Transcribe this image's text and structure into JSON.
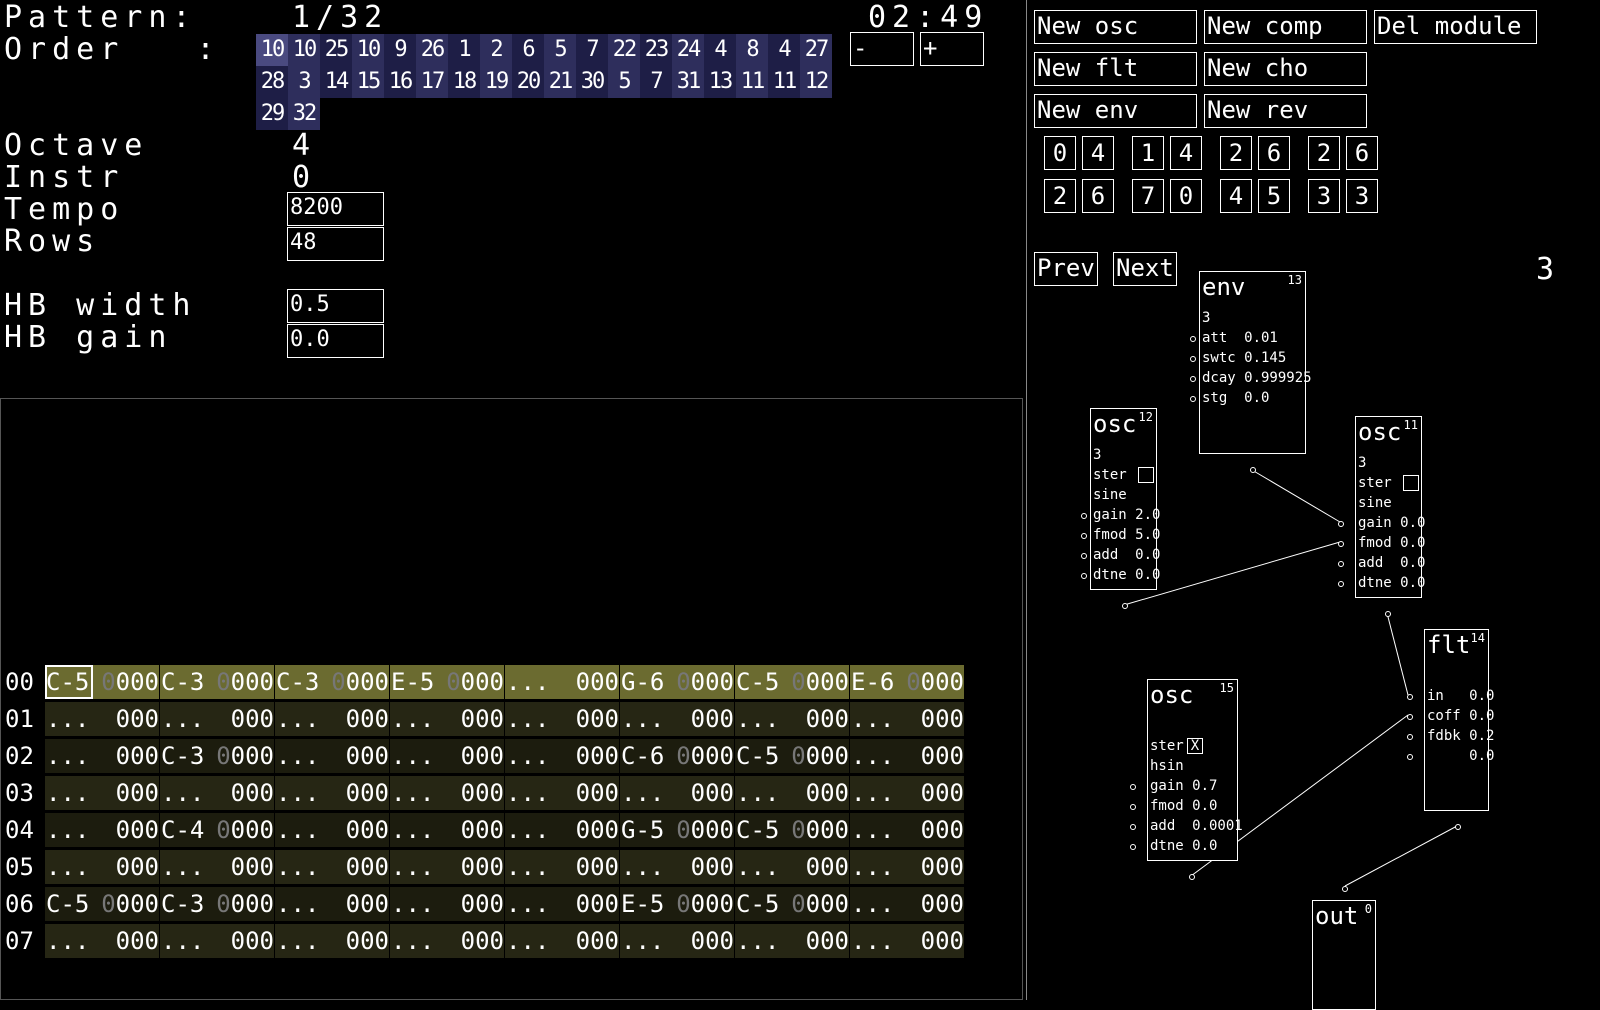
{
  "header": {
    "pattern_label": "Pattern:",
    "pattern_value": "1/32",
    "time": "02:49",
    "order_label": "Order   :",
    "order_cells": [
      "10",
      "10",
      "25",
      "10",
      "9",
      "26",
      "1",
      "2",
      "6",
      "5",
      "7",
      "22",
      "23",
      "24",
      "4",
      "8",
      "4",
      "27",
      "28",
      "3",
      "14",
      "15",
      "16",
      "17",
      "18",
      "19",
      "20",
      "21",
      "30",
      "5",
      "7",
      "31",
      "13",
      "11",
      "11",
      "12",
      "29",
      "32"
    ],
    "order_minus": "-",
    "order_plus": "+",
    "octave_label": "Octave",
    "octave_value": "4",
    "instr_label": "Instr",
    "instr_value": "0",
    "tempo_label": "Tempo",
    "tempo_value": "8200",
    "rows_label": "Rows",
    "rows_value": "48",
    "hb_width_label": "HB width",
    "hb_width_value": "0.5",
    "hb_gain_label": "HB gain",
    "hb_gain_value": "0.0"
  },
  "pattern": {
    "rows": [
      {
        "num": "00",
        "cells": [
          {
            "n": "C-5",
            "d": "0000"
          },
          {
            "n": "C-3",
            "d": "0000"
          },
          {
            "n": "C-3",
            "d": "0000"
          },
          {
            "n": "E-5",
            "d": "0000"
          },
          {
            "n": "...",
            "d": "000"
          },
          {
            "n": "G-6",
            "d": "0000"
          },
          {
            "n": "C-5",
            "d": "0000"
          },
          {
            "n": "E-6",
            "d": "0000"
          }
        ]
      },
      {
        "num": "01",
        "cells": [
          {
            "n": "...",
            "d": "000"
          },
          {
            "n": "...",
            "d": "000"
          },
          {
            "n": "...",
            "d": "000"
          },
          {
            "n": "...",
            "d": "000"
          },
          {
            "n": "...",
            "d": "000"
          },
          {
            "n": "...",
            "d": "000"
          },
          {
            "n": "...",
            "d": "000"
          },
          {
            "n": "...",
            "d": "000"
          }
        ]
      },
      {
        "num": "02",
        "cells": [
          {
            "n": "...",
            "d": "000"
          },
          {
            "n": "C-3",
            "d": "0000"
          },
          {
            "n": "...",
            "d": "000"
          },
          {
            "n": "...",
            "d": "000"
          },
          {
            "n": "...",
            "d": "000"
          },
          {
            "n": "C-6",
            "d": "0000"
          },
          {
            "n": "C-5",
            "d": "0000"
          },
          {
            "n": "...",
            "d": "000"
          }
        ]
      },
      {
        "num": "03",
        "cells": [
          {
            "n": "...",
            "d": "000"
          },
          {
            "n": "...",
            "d": "000"
          },
          {
            "n": "...",
            "d": "000"
          },
          {
            "n": "...",
            "d": "000"
          },
          {
            "n": "...",
            "d": "000"
          },
          {
            "n": "...",
            "d": "000"
          },
          {
            "n": "...",
            "d": "000"
          },
          {
            "n": "...",
            "d": "000"
          }
        ]
      },
      {
        "num": "04",
        "cells": [
          {
            "n": "...",
            "d": "000"
          },
          {
            "n": "C-4",
            "d": "0000"
          },
          {
            "n": "...",
            "d": "000"
          },
          {
            "n": "...",
            "d": "000"
          },
          {
            "n": "...",
            "d": "000"
          },
          {
            "n": "G-5",
            "d": "0000"
          },
          {
            "n": "C-5",
            "d": "0000"
          },
          {
            "n": "...",
            "d": "000"
          }
        ]
      },
      {
        "num": "05",
        "cells": [
          {
            "n": "...",
            "d": "000"
          },
          {
            "n": "...",
            "d": "000"
          },
          {
            "n": "...",
            "d": "000"
          },
          {
            "n": "...",
            "d": "000"
          },
          {
            "n": "...",
            "d": "000"
          },
          {
            "n": "...",
            "d": "000"
          },
          {
            "n": "...",
            "d": "000"
          },
          {
            "n": "...",
            "d": "000"
          }
        ]
      },
      {
        "num": "06",
        "cells": [
          {
            "n": "C-5",
            "d": "0000"
          },
          {
            "n": "C-3",
            "d": "0000"
          },
          {
            "n": "...",
            "d": "000"
          },
          {
            "n": "...",
            "d": "000"
          },
          {
            "n": "...",
            "d": "000"
          },
          {
            "n": "E-5",
            "d": "0000"
          },
          {
            "n": "C-5",
            "d": "0000"
          },
          {
            "n": "...",
            "d": "000"
          }
        ]
      },
      {
        "num": "07",
        "cells": [
          {
            "n": "...",
            "d": "000"
          },
          {
            "n": "...",
            "d": "000"
          },
          {
            "n": "...",
            "d": "000"
          },
          {
            "n": "...",
            "d": "000"
          },
          {
            "n": "...",
            "d": "000"
          },
          {
            "n": "...",
            "d": "000"
          },
          {
            "n": "...",
            "d": "000"
          },
          {
            "n": "...",
            "d": "000"
          }
        ]
      }
    ]
  },
  "toolbar": {
    "new_osc": "New osc",
    "new_comp": "New comp",
    "del_module": "Del module",
    "new_flt": "New flt",
    "new_cho": "New cho",
    "new_env": "New env",
    "new_rev": "New rev",
    "prev": "Prev",
    "next": "Next",
    "page_number": "3"
  },
  "number_grid": {
    "row1": [
      "0",
      "4",
      "1",
      "4",
      "2",
      "6",
      "2",
      "6"
    ],
    "row2": [
      "2",
      "6",
      "7",
      "0",
      "4",
      "5",
      "3",
      "3"
    ]
  },
  "modules": {
    "env13": {
      "title": "env",
      "id": "13",
      "sub": "3",
      "params": [
        "att  0.01",
        "swtc 0.145",
        "dcay 0.999925",
        "stg  0.0"
      ]
    },
    "osc12": {
      "title": "osc",
      "id": "12",
      "sub": "3",
      "ster": "ster",
      "wave": "sine",
      "params": [
        "gain 2.0",
        "fmod 5.0",
        "add  0.0",
        "dtne 0.0"
      ]
    },
    "osc11": {
      "title": "osc",
      "id": "11",
      "sub": "3",
      "ster": "ster",
      "wave": "sine",
      "params": [
        "gain 0.0",
        "fmod 0.0",
        "add  0.0",
        "dtne 0.0"
      ]
    },
    "flt14": {
      "title": "flt",
      "id": "14",
      "params": [
        "in   0.0",
        "coff 0.0",
        "fdbk 0.2",
        "     0.0"
      ]
    },
    "osc15": {
      "title": "osc",
      "id": "15",
      "ster": "ster",
      "ster_checked": "X",
      "wave": "hsin",
      "params": [
        "gain 0.7",
        "fmod 0.0",
        "add  0.0001",
        "dtne 0.0"
      ]
    },
    "out0": {
      "title": "out",
      "id": "0"
    }
  }
}
